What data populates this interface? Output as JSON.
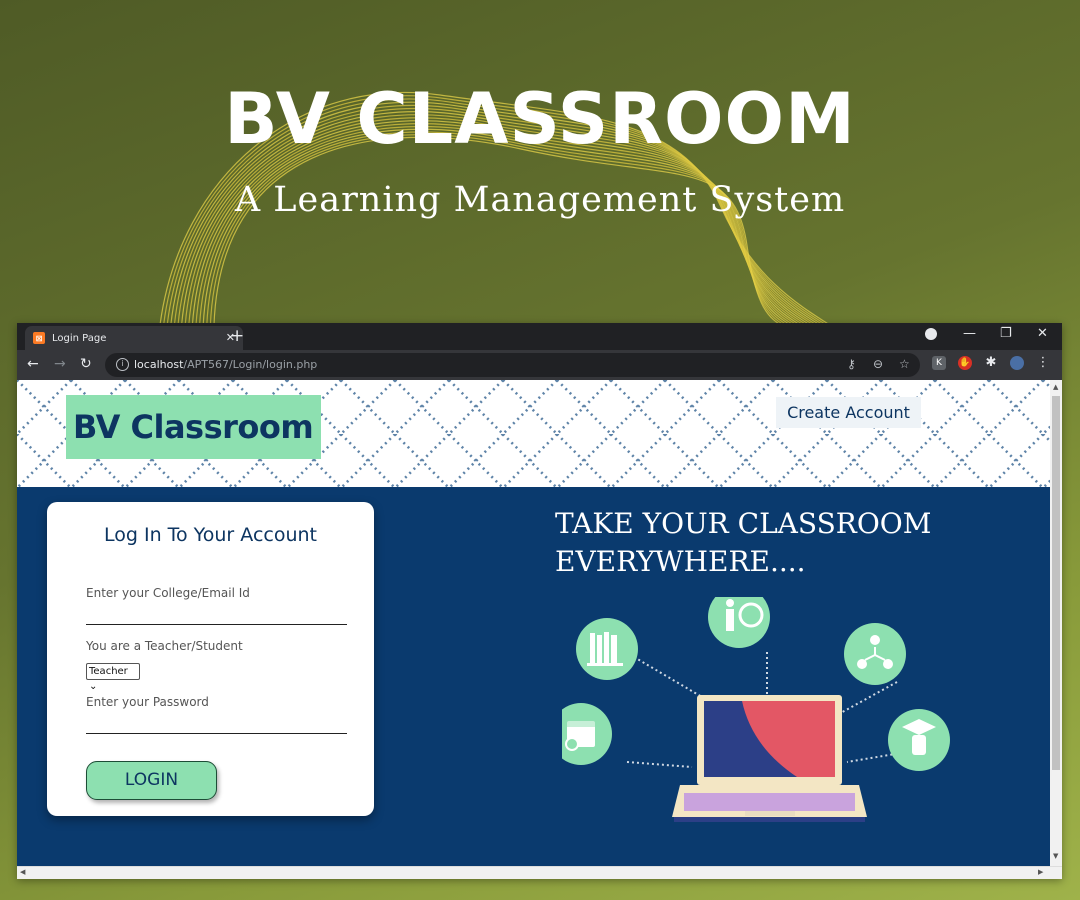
{
  "hero": {
    "title": "BV CLASSROOM",
    "subtitle": "A Learning Management System"
  },
  "browser": {
    "tab_title": "Login Page",
    "tab_close": "✕",
    "new_tab": "+",
    "url_host": "localhost",
    "url_path": "/APT567/Login/login.php"
  },
  "page": {
    "logo": "BV Classroom",
    "create_account": "Create Account",
    "login_card": {
      "title": "Log  In To Your Account",
      "email_label": "Enter your College/Email Id",
      "role_label": "You are a Teacher/Student",
      "role_selected": "Teacher",
      "password_label": "Enter your Password",
      "login_button": "LOGIN"
    },
    "tagline_line1": "TAKE YOUR CLASSROOM",
    "tagline_line2": "EVERYWHERE...."
  },
  "colors": {
    "mint": "#8de0b0",
    "navy": "#0a3a6e",
    "dark_text": "#0d3561"
  },
  "icons": [
    "books-icon",
    "teacher-icon",
    "people-network-icon",
    "calendar-icon",
    "graduation-cap-icon",
    "laptop-icon"
  ]
}
